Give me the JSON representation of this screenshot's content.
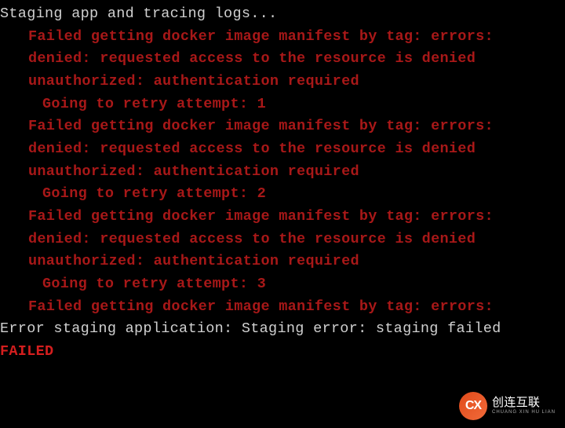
{
  "terminal": {
    "status_line": "Staging app and tracing logs...",
    "error_block_1": {
      "line1": "Failed getting docker image manifest by tag: errors:",
      "line2": "denied: requested access to the resource is denied",
      "line3": "unauthorized: authentication required",
      "retry": "Going to retry attempt: 1"
    },
    "error_block_2": {
      "line1": "Failed getting docker image manifest by tag: errors:",
      "line2": "denied: requested access to the resource is denied",
      "line3": "unauthorized: authentication required",
      "retry": "Going to retry attempt: 2"
    },
    "error_block_3": {
      "line1": "Failed getting docker image manifest by tag: errors:",
      "line2": "denied: requested access to the resource is denied",
      "line3": "unauthorized: authentication required",
      "retry": "Going to retry attempt: 3"
    },
    "error_block_4": {
      "line1": "Failed getting docker image manifest by tag: errors:"
    },
    "summary": "Error staging application: Staging error: staging failed",
    "failed": "FAILED"
  },
  "watermark": {
    "logo_text": "CX",
    "main": "创连互联",
    "sub": "CHUANG XIN HU LIAN"
  }
}
